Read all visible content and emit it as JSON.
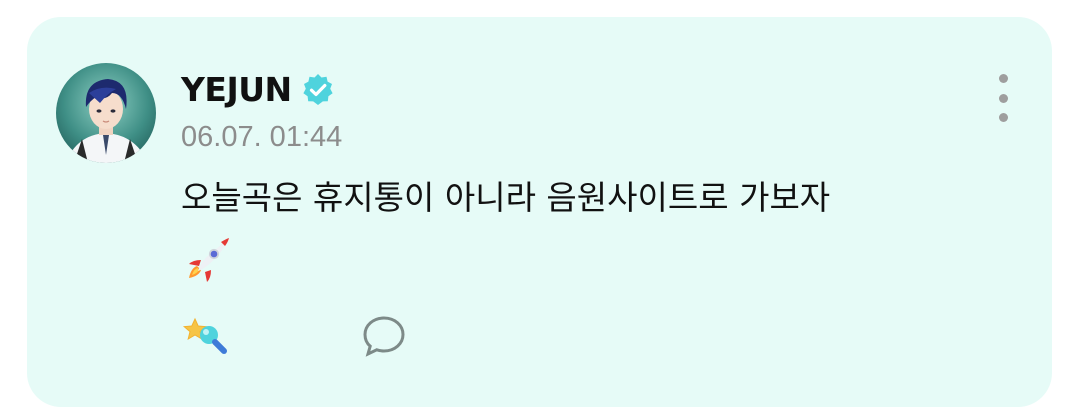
{
  "post": {
    "author": {
      "name": "YEJUN",
      "verified": true,
      "avatar_icon": "avatar-illustration"
    },
    "timestamp": "06.07. 01:44",
    "text": "오늘곡은 휴지통이 아니라 음원사이트로 가보자",
    "emoji": "🚀",
    "menu_icon": "more-vertical-icon",
    "actions": {
      "like": {
        "icon": "star-wand-icon",
        "count": ""
      },
      "comment": {
        "icon": "speech-bubble-icon",
        "count": ""
      }
    }
  },
  "colors": {
    "card_background": "#e6fbf7",
    "verified_badge": "#4fd3dd",
    "text_primary": "#111111",
    "text_secondary": "#8c8c8c"
  }
}
